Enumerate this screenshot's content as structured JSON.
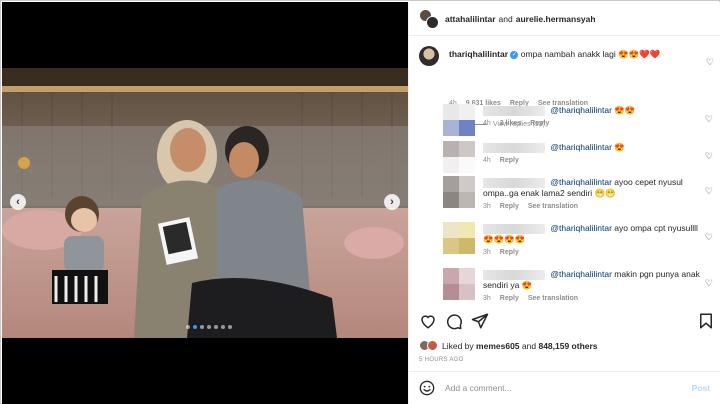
{
  "header": {
    "user1": "attahalilintar",
    "joiner": "and",
    "user2": "aurelie.hermansyah"
  },
  "main_comment": {
    "username": "thariqhalilintar",
    "text": "ompa nambah anakk lagi",
    "emoji": "😍😍❤️❤️",
    "time": "4h",
    "likes": "9,631 likes",
    "reply": "Reply",
    "translate": "See translation",
    "view_replies": "View replies (93)"
  },
  "replies": [
    {
      "mention": "@thariqhalilintar",
      "text": "",
      "emoji": "😍😍",
      "time": "4h",
      "likes": "2 likes",
      "reply": "Reply",
      "translate": ""
    },
    {
      "mention": "@thariqhalilintar",
      "text": "",
      "emoji": "😍",
      "time": "4h",
      "likes": "",
      "reply": "Reply",
      "translate": ""
    },
    {
      "mention": "@thariqhalilintar",
      "text": "ayoo cepet nyusul ompa..ga enak lama2 sendiri",
      "emoji": "😁😁",
      "time": "3h",
      "likes": "",
      "reply": "Reply",
      "translate": "See translation"
    },
    {
      "mention": "@thariqhalilintar",
      "text": "ayo ompa cpt nyusullll",
      "emoji": "😍😍😍😍",
      "time": "3h",
      "likes": "",
      "reply": "Reply",
      "translate": ""
    },
    {
      "mention": "@thariqhalilintar",
      "text": "makin pgn punya anak sendiri ya",
      "emoji": "😍",
      "time": "3h",
      "likes": "",
      "reply": "Reply",
      "translate": "See translation"
    }
  ],
  "liked": {
    "prefix": "Liked by",
    "user": "memes605",
    "and": "and",
    "count": "848,159 others"
  },
  "time_ago": "5 HOURS AGO",
  "add_comment": {
    "placeholder": "Add a comment...",
    "post": "Post"
  },
  "carousel": {
    "total_slides": 7,
    "active_slide": 1
  },
  "icons": [
    "chevron-left-icon",
    "chevron-right-icon",
    "heart-icon",
    "comment-icon",
    "share-icon",
    "bookmark-icon",
    "emoji-icon"
  ],
  "colors": {
    "accent": "#3897f0",
    "muted": "#8e8e8e",
    "mention": "#00376b",
    "post_disabled": "#b3dbff"
  }
}
